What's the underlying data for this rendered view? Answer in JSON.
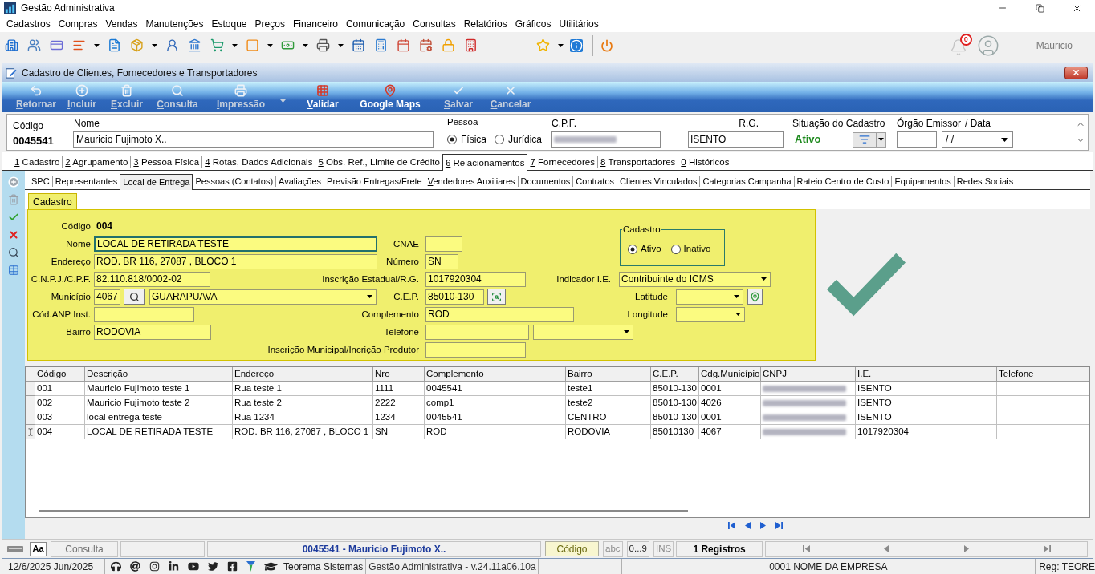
{
  "window": {
    "title": "Gestão Administrativa"
  },
  "menu": [
    "Cadastros",
    "Compras",
    "Vendas",
    "Manutenções",
    "Estoque",
    "Preços",
    "Financeiro",
    "Comunicação",
    "Consultas",
    "Relatórios",
    "Gráficos",
    "Utilitários"
  ],
  "toolbar": {
    "notifications": "0",
    "user": "Mauricio"
  },
  "child_window": {
    "title": "Cadastro de Clientes, Fornecedores e Transportadores",
    "actions": [
      {
        "label": "Retornar",
        "disabled": true,
        "hotkey": true,
        "dropdown": false
      },
      {
        "label": "Incluir",
        "disabled": true,
        "hotkey": true,
        "dropdown": false
      },
      {
        "label": "Excluir",
        "disabled": true,
        "hotkey": true,
        "dropdown": false
      },
      {
        "label": "Consulta",
        "disabled": true,
        "hotkey": true,
        "dropdown": false
      },
      {
        "label": "Impressão",
        "disabled": true,
        "hotkey": true,
        "dropdown": true
      },
      {
        "label": "Validar",
        "disabled": false,
        "hotkey": true,
        "dropdown": false
      },
      {
        "label": "Google Maps",
        "disabled": false,
        "hotkey": false,
        "dropdown": false
      },
      {
        "label": "Salvar",
        "disabled": true,
        "hotkey": true,
        "dropdown": false
      },
      {
        "label": "Cancelar",
        "disabled": true,
        "hotkey": true,
        "dropdown": false
      }
    ],
    "record": {
      "code": {
        "label": "Código",
        "value": "0045541"
      },
      "name": {
        "label": "Nome",
        "value": "Mauricio Fujimoto X.."
      },
      "person_type": {
        "label": "Pessoa",
        "options": [
          {
            "label": "Física",
            "selected": true
          },
          {
            "label": "Jurídica",
            "selected": false
          }
        ]
      },
      "cpf": {
        "label": "C.P.F."
      },
      "rg": {
        "label": "R.G.",
        "value": "ISENTO"
      },
      "status": {
        "label": "Situação do Cadastro",
        "value": "Ativo"
      },
      "issuer": {
        "label": "Órgão Emissor"
      },
      "date": {
        "label": "/ Data",
        "value": "/ /"
      }
    },
    "tabs": [
      {
        "key": "1",
        "label": "Cadastro",
        "selected": false
      },
      {
        "key": "2",
        "label": "Agrupamento",
        "selected": false
      },
      {
        "key": "3",
        "label": "Pessoa Física",
        "selected": false
      },
      {
        "key": "4",
        "label": "Rotas, Dados Adicionais",
        "selected": false
      },
      {
        "key": "5",
        "label": "Obs. Ref., Limite de Crédito",
        "selected": false
      },
      {
        "key": "6",
        "label": "Relacionamentos",
        "selected": true
      },
      {
        "key": "7",
        "label": "Fornecedores",
        "selected": false
      },
      {
        "key": "8",
        "label": "Transportadores",
        "selected": false
      },
      {
        "key": "0",
        "label": "Históricos",
        "selected": false
      }
    ],
    "sub_tabs": [
      {
        "label": "SPC",
        "selected": false,
        "hotkey": false
      },
      {
        "label": "Representantes",
        "selected": false,
        "hotkey": false
      },
      {
        "label": "Local de Entrega",
        "selected": true,
        "hotkey": false
      },
      {
        "label": "Pessoas (Contatos)",
        "selected": false,
        "hotkey": false
      },
      {
        "label": "Avaliações",
        "selected": false,
        "hotkey": false
      },
      {
        "label": "Previsão Entregas/Frete",
        "selected": false,
        "hotkey": false
      },
      {
        "label": "Vendedores Auxiliares",
        "selected": false,
        "hotkey": true
      },
      {
        "label": "Documentos",
        "selected": false,
        "hotkey": false
      },
      {
        "label": "Contratos",
        "selected": false,
        "hotkey": false
      },
      {
        "label": "Clientes Vinculados",
        "selected": false,
        "hotkey": false
      },
      {
        "label": "Categorias Campanha",
        "selected": false,
        "hotkey": false
      },
      {
        "label": "Rateio Centro de Custo",
        "selected": false,
        "hotkey": false
      },
      {
        "label": "Equipamentos",
        "selected": false,
        "hotkey": false
      },
      {
        "label": "Redes Sociais",
        "selected": false,
        "hotkey": false
      }
    ],
    "location_form": {
      "tabs": [
        {
          "label": "Cadastro",
          "selected": true
        }
      ],
      "code": {
        "label": "Código",
        "value": "004"
      },
      "name": {
        "label": "Nome",
        "value": "LOCAL DE RETIRADA TESTE",
        "focused": true
      },
      "cnae": {
        "label": "CNAE"
      },
      "status_group": {
        "title": "Cadastro",
        "options": [
          {
            "label": "Ativo",
            "selected": true
          },
          {
            "label": "Inativo",
            "selected": false
          }
        ]
      },
      "address": {
        "label": "Endereço",
        "value": "ROD. BR 116, 27087 , BLOCO 1"
      },
      "number": {
        "label": "Número",
        "value": "SN"
      },
      "tax_id": {
        "label": "C.N.P.J./C.P.F.",
        "value": "82.110.818/0002-02"
      },
      "state_registration": {
        "label": "Inscrição Estadual/R.G.",
        "value": "1017920304"
      },
      "ie_indicator": {
        "label": "Indicador I.E.",
        "value": "Contribuinte do ICMS"
      },
      "city": {
        "label": "Município",
        "code": "4067",
        "value": "GUARAPUAVA"
      },
      "zip": {
        "label": "C.E.P.",
        "value": "85010-130"
      },
      "latitude": {
        "label": "Latitude"
      },
      "anp_code": {
        "label": "Cód.ANP Inst."
      },
      "complement": {
        "label": "Complemento",
        "value": "ROD"
      },
      "longitude": {
        "label": "Longitude"
      },
      "district": {
        "label": "Bairro",
        "value": "RODOVIA"
      },
      "phone": {
        "label": "Telefone"
      },
      "municipal_registration": {
        "label": "Inscrição Municipal/Incrição Produtor"
      }
    },
    "table": {
      "columns": [
        "Código",
        "Descrição",
        "Endereço",
        "Nro",
        "Complemento",
        "Bairro",
        "C.E.P.",
        "Cdg.Município",
        "CNPJ",
        "I.E.",
        "Telefone"
      ],
      "rows": [
        {
          "current": false,
          "code": "001",
          "description": "Mauricio Fujimoto teste 1",
          "address": "Rua teste 1",
          "number": "1111",
          "complement": "0045541",
          "district": "teste1",
          "zip": "85010-130",
          "city_code": "0001",
          "ie": "ISENTO"
        },
        {
          "current": false,
          "code": "002",
          "description": "Mauricio Fujimoto teste 2",
          "address": "Rua teste 2",
          "number": "2222",
          "complement": "comp1",
          "district": "teste2",
          "zip": "85010-130",
          "city_code": "4026",
          "ie": "ISENTO"
        },
        {
          "current": false,
          "code": "003",
          "description": "local entrega teste",
          "address": "Rua 1234",
          "number": "1234",
          "complement": "0045541",
          "district": "CENTRO",
          "zip": "85010-130",
          "city_code": "0001",
          "ie": "ISENTO"
        },
        {
          "current": true,
          "code": "004",
          "description": "LOCAL DE RETIRADA TESTE",
          "address": "ROD. BR 116, 27087 , BLOCO 1",
          "number": "SN",
          "complement": "ROD",
          "district": "RODOVIA",
          "zip": "85010130",
          "city_code": "4067",
          "ie": "1017920304"
        }
      ]
    },
    "status_bar": {
      "font_button": "Aa",
      "mode": "Consulta",
      "record": "0045541 - Mauricio Fujimoto X..",
      "sort_button": "Código",
      "indicators": [
        {
          "label": "abc",
          "active": false
        },
        {
          "label": "0...9",
          "active": true
        },
        {
          "label": "INS",
          "active": false
        }
      ],
      "count": "1 Registros"
    }
  },
  "footer": {
    "date": "12/6/2025 Jun/2025",
    "brand": "Teorema Sistemas",
    "version": "Gestão Administrativa - v.24.11a06.10a",
    "company": "0001 NOME DA EMPRESA",
    "registration": "Reg: TEORE"
  }
}
